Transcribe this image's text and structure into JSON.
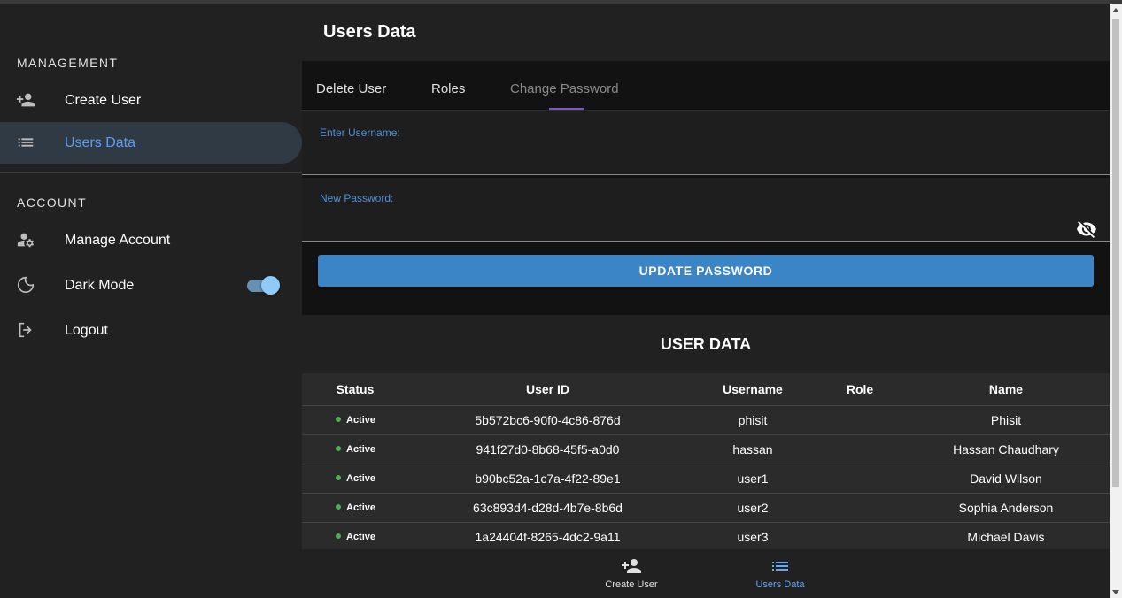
{
  "sidebar": {
    "management_header": "MANAGEMENT",
    "account_header": "ACCOUNT",
    "items": [
      {
        "label": "Create User",
        "icon": "person-add-icon"
      },
      {
        "label": "Users Data",
        "icon": "list-icon",
        "active": true
      },
      {
        "label": "Manage Account",
        "icon": "manage-accounts-icon"
      },
      {
        "label": "Dark Mode",
        "icon": "moon-icon"
      },
      {
        "label": "Logout",
        "icon": "logout-icon"
      }
    ],
    "dark_mode_on": true
  },
  "header": {
    "title": "Users Data"
  },
  "tabs": [
    {
      "label": "Delete User"
    },
    {
      "label": "Roles"
    },
    {
      "label": "Change Password",
      "active": true
    }
  ],
  "form": {
    "username_label": "Enter Username:",
    "username_value": "",
    "password_label": "New Password:",
    "password_value": "",
    "submit_label": "UPDATE PASSWORD"
  },
  "user_data": {
    "title": "USER DATA",
    "columns": [
      "Status",
      "User ID",
      "Username",
      "Role",
      "Name"
    ],
    "rows": [
      {
        "status": "Active",
        "id": "5b572bc6-90f0-4c86-876d",
        "username": "phisit",
        "role": "",
        "name": "Phisit"
      },
      {
        "status": "Active",
        "id": "941f27d0-8b68-45f5-a0d0",
        "username": "hassan",
        "role": "",
        "name": "Hassan Chaudhary"
      },
      {
        "status": "Active",
        "id": "b90bc52a-1c7a-4f22-89e1",
        "username": "user1",
        "role": "",
        "name": "David Wilson"
      },
      {
        "status": "Active",
        "id": "63c893d4-d28d-4b7e-8b6d",
        "username": "user2",
        "role": "",
        "name": "Sophia Anderson"
      },
      {
        "status": "Active",
        "id": "1a24404f-8265-4dc2-9a11",
        "username": "user3",
        "role": "",
        "name": "Michael Davis"
      }
    ]
  },
  "bottom_nav": [
    {
      "label": "Create User",
      "icon": "person-add-icon"
    },
    {
      "label": "Users Data",
      "icon": "list-icon",
      "active": true
    }
  ],
  "colors": {
    "accent": "#5b9ff0",
    "button": "#3b84c6",
    "tab_indicator": "#7e57c2",
    "status_active": "#4caf50"
  }
}
